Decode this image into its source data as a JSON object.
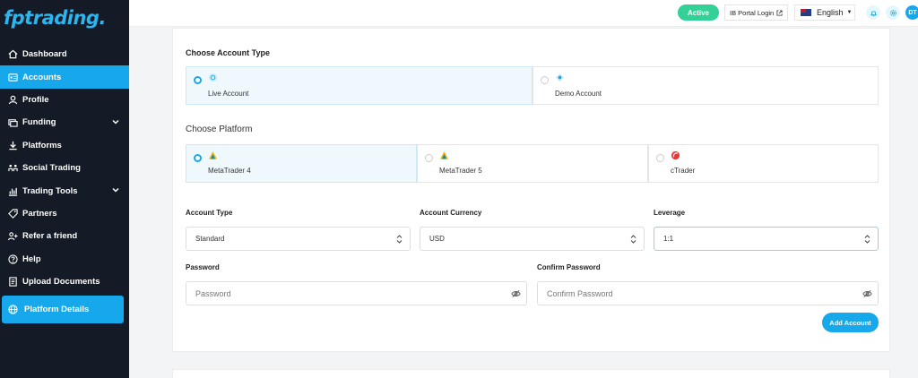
{
  "sidebar": {
    "logo": "fptrading",
    "logo_dot": ".",
    "items": [
      {
        "label": "Dashboard",
        "icon": "home-icon",
        "active": false,
        "chevron": false
      },
      {
        "label": "Accounts",
        "icon": "accounts-icon",
        "active": true,
        "chevron": false
      },
      {
        "label": "Profile",
        "icon": "profile-icon",
        "active": false,
        "chevron": false
      },
      {
        "label": "Funding",
        "icon": "funding-icon",
        "active": false,
        "chevron": true
      },
      {
        "label": "Platforms",
        "icon": "download-icon",
        "active": false,
        "chevron": false
      },
      {
        "label": "Social Trading",
        "icon": "social-icon",
        "active": false,
        "chevron": false
      },
      {
        "label": "Trading Tools",
        "icon": "tools-icon",
        "active": false,
        "chevron": true
      },
      {
        "label": "Partners",
        "icon": "tag-icon",
        "active": false,
        "chevron": false
      },
      {
        "label": "Refer a friend",
        "icon": "refer-icon",
        "active": false,
        "chevron": false
      },
      {
        "label": "Help",
        "icon": "help-icon",
        "active": false,
        "chevron": false
      },
      {
        "label": "Upload Documents",
        "icon": "upload-icon",
        "active": false,
        "chevron": false
      }
    ],
    "platform_details": "Platform Details"
  },
  "header": {
    "status": "Active",
    "ib_portal": "IB Portal Login",
    "language": "English",
    "avatar_initials": "DT"
  },
  "form": {
    "account_type_title": "Choose Account Type",
    "account_options": [
      {
        "label": "Live Account",
        "selected": true
      },
      {
        "label": "Demo Account",
        "selected": false
      }
    ],
    "platform_title": "Choose Platform",
    "platform_options": [
      {
        "label": "MetaTrader 4",
        "selected": true
      },
      {
        "label": "MetaTrader 5",
        "selected": false
      },
      {
        "label": "cTrader",
        "selected": false
      }
    ],
    "account_type_label": "Account Type",
    "account_type_value": "Standard",
    "currency_label": "Account Currency",
    "currency_value": "USD",
    "leverage_label": "Leverage",
    "leverage_value": "1:1",
    "password_label": "Password",
    "password_placeholder": "Password",
    "confirm_label": "Confirm Password",
    "confirm_placeholder": "Confirm Password",
    "submit_label": "Add Account"
  },
  "colors": {
    "accent": "#17a8ec",
    "sidebar_bg": "#141b26",
    "status_green": "#33d197"
  }
}
